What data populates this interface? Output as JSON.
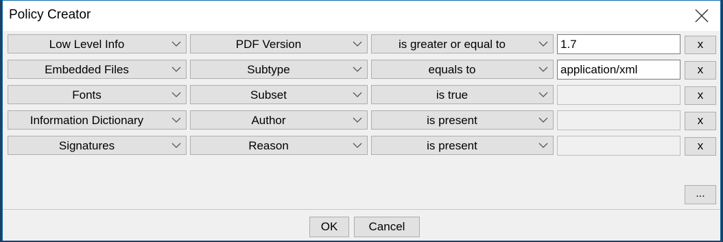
{
  "window": {
    "title": "Policy Creator"
  },
  "rules": [
    {
      "category": "Low Level Info",
      "property": "PDF Version",
      "operator": "is greater or equal to",
      "value": "1.7",
      "remove_label": "x"
    },
    {
      "category": "Embedded Files",
      "property": "Subtype",
      "operator": "equals to",
      "value": "application/xml",
      "remove_label": "x"
    },
    {
      "category": "Fonts",
      "property": "Subset",
      "operator": "is true",
      "value": "",
      "remove_label": "x"
    },
    {
      "category": "Information Dictionary",
      "property": "Author",
      "operator": "is present",
      "value": "",
      "remove_label": "x"
    },
    {
      "category": "Signatures",
      "property": "Reason",
      "operator": "is present",
      "value": "",
      "remove_label": "x"
    }
  ],
  "more_label": "...",
  "footer": {
    "ok_label": "OK",
    "cancel_label": "Cancel"
  },
  "icons": {
    "close": "close-x-icon",
    "dropdown": "chevron-down-icon"
  },
  "colors": {
    "background": "#f0f0f0",
    "button": "#e1e1e1",
    "border": "#adadad"
  }
}
